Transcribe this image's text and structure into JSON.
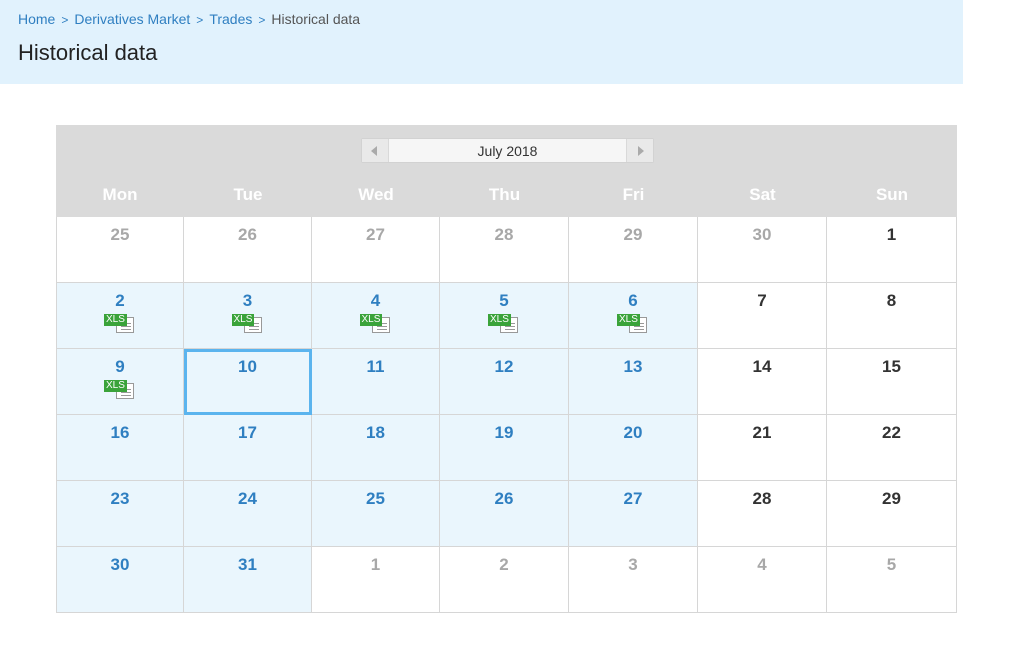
{
  "breadcrumb": {
    "items": [
      "Home",
      "Derivatives Market",
      "Trades"
    ],
    "separator": ">",
    "current": "Historical data"
  },
  "page": {
    "title": "Historical data"
  },
  "calendar": {
    "month_label": "July 2018",
    "weekdays": [
      "Mon",
      "Tue",
      "Wed",
      "Thu",
      "Fri",
      "Sat",
      "Sun"
    ],
    "xls_label": "XLS",
    "weeks": [
      [
        {
          "d": "25",
          "t": "other"
        },
        {
          "d": "26",
          "t": "other"
        },
        {
          "d": "27",
          "t": "other"
        },
        {
          "d": "28",
          "t": "other"
        },
        {
          "d": "29",
          "t": "other"
        },
        {
          "d": "30",
          "t": "other"
        },
        {
          "d": "1",
          "t": "weekend"
        }
      ],
      [
        {
          "d": "2",
          "t": "working",
          "xls": true
        },
        {
          "d": "3",
          "t": "working",
          "xls": true
        },
        {
          "d": "4",
          "t": "working",
          "xls": true
        },
        {
          "d": "5",
          "t": "working",
          "xls": true
        },
        {
          "d": "6",
          "t": "working",
          "xls": true
        },
        {
          "d": "7",
          "t": "weekend"
        },
        {
          "d": "8",
          "t": "weekend"
        }
      ],
      [
        {
          "d": "9",
          "t": "working",
          "xls": true
        },
        {
          "d": "10",
          "t": "working",
          "today": true
        },
        {
          "d": "11",
          "t": "working"
        },
        {
          "d": "12",
          "t": "working"
        },
        {
          "d": "13",
          "t": "working"
        },
        {
          "d": "14",
          "t": "weekend"
        },
        {
          "d": "15",
          "t": "weekend"
        }
      ],
      [
        {
          "d": "16",
          "t": "working"
        },
        {
          "d": "17",
          "t": "working"
        },
        {
          "d": "18",
          "t": "working"
        },
        {
          "d": "19",
          "t": "working"
        },
        {
          "d": "20",
          "t": "working"
        },
        {
          "d": "21",
          "t": "weekend"
        },
        {
          "d": "22",
          "t": "weekend"
        }
      ],
      [
        {
          "d": "23",
          "t": "working"
        },
        {
          "d": "24",
          "t": "working"
        },
        {
          "d": "25",
          "t": "working"
        },
        {
          "d": "26",
          "t": "working"
        },
        {
          "d": "27",
          "t": "working"
        },
        {
          "d": "28",
          "t": "weekend"
        },
        {
          "d": "29",
          "t": "weekend"
        }
      ],
      [
        {
          "d": "30",
          "t": "working"
        },
        {
          "d": "31",
          "t": "working"
        },
        {
          "d": "1",
          "t": "other"
        },
        {
          "d": "2",
          "t": "other"
        },
        {
          "d": "3",
          "t": "other"
        },
        {
          "d": "4",
          "t": "other"
        },
        {
          "d": "5",
          "t": "other"
        }
      ]
    ]
  },
  "colors": {
    "header_bg": "#e1f2fd",
    "link": "#2f7fc1",
    "working_day_bg": "#eaf6fd",
    "calendar_header_bg": "#dadada",
    "today_outline": "#5bb4ee",
    "xls_badge": "#3aa33a"
  },
  "icons": {
    "prev": "triangle-left-icon",
    "next": "triangle-right-icon",
    "file": "xls-file-icon"
  }
}
